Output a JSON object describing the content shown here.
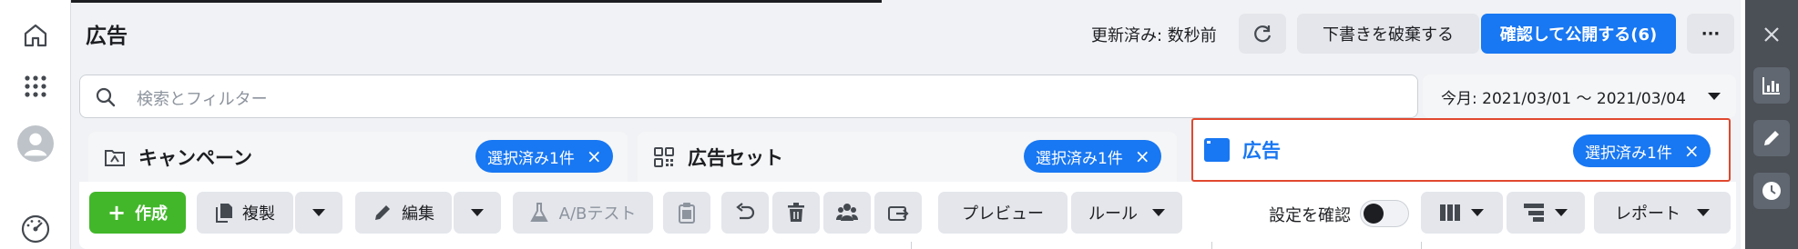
{
  "header": {
    "title": "広告",
    "updated": "更新済み: 数秒前",
    "discard_label": "下書きを破棄する",
    "publish_label": "確認して公開する(6)",
    "more_label": "···"
  },
  "search": {
    "placeholder": "検索とフィルター"
  },
  "date_range": {
    "label": "今月: 2021/03/01 〜 2021/03/04"
  },
  "tabs": [
    {
      "title": "キャンペーン",
      "badge": "選択済み1件"
    },
    {
      "title": "広告セット",
      "badge": "選択済み1件"
    },
    {
      "title": "広告",
      "badge": "選択済み1件"
    }
  ],
  "toolbar": {
    "create_label": "作成",
    "duplicate_label": "複製",
    "edit_label": "編集",
    "ab_test_label": "A/Bテスト",
    "preview_label": "プレビュー",
    "rules_label": "ルール",
    "review_settings_label": "設定を確認",
    "reports_label": "レポート"
  },
  "colors": {
    "accent": "#1877f2",
    "create": "#42b72a",
    "highlight": "#e0482f"
  },
  "icons": {
    "left_nav": [
      "home-icon",
      "apps-grid-icon",
      "avatar",
      "dashboard-gauge-icon"
    ],
    "right_panel": [
      "close-icon",
      "bar-chart-icon",
      "pencil-icon",
      "clock-icon"
    ]
  }
}
